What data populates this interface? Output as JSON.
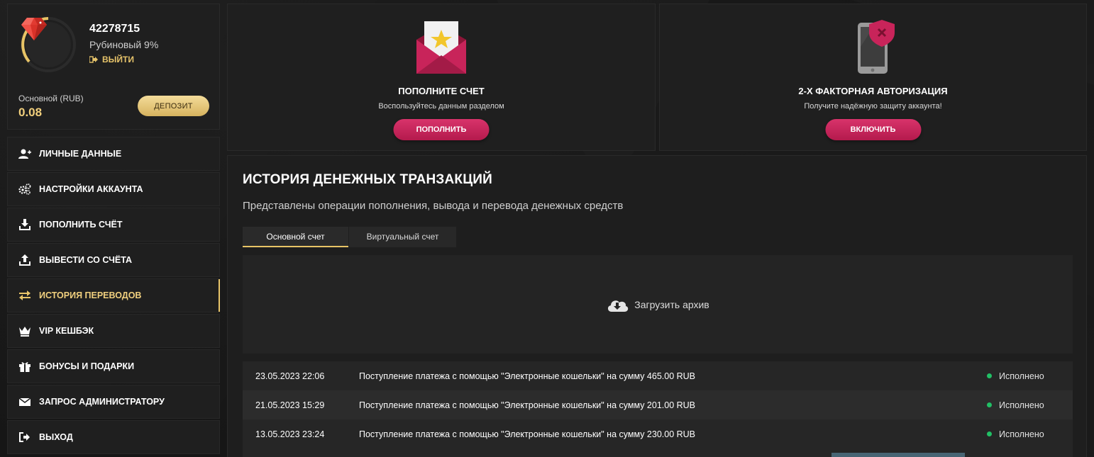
{
  "profile": {
    "user_id": "42278715",
    "level": "Рубиновый 9%",
    "logout_label": "ВЫЙТИ",
    "balance_label": "Основной (RUB)",
    "balance_value": "0.08",
    "deposit_label": "ДЕПОЗИТ",
    "level_progress_percent": 9
  },
  "menu": [
    {
      "label": "ЛИЧНЫЕ ДАННЫЕ",
      "icon": "user-plus-icon",
      "active": false
    },
    {
      "label": "НАСТРОЙКИ АККАУНТА",
      "icon": "gears-icon",
      "active": false
    },
    {
      "label": "ПОПОЛНИТЬ СЧЁТ",
      "icon": "download-tray-icon",
      "active": false
    },
    {
      "label": "ВЫВЕСТИ СО СЧЁТА",
      "icon": "upload-tray-icon",
      "active": false
    },
    {
      "label": "ИСТОРИЯ ПЕРЕВОДОВ",
      "icon": "exchange-arrows-icon",
      "active": true
    },
    {
      "label": "VIP КЕШБЭК",
      "icon": "crown-icon",
      "active": false
    },
    {
      "label": "БОНУСЫ И ПОДАРКИ",
      "icon": "gift-icon",
      "active": false
    },
    {
      "label": "ЗАПРОС АДМИНИСТРАТОРУ",
      "icon": "envelope-icon",
      "active": false
    },
    {
      "label": "ВЫХОД",
      "icon": "sign-out-icon",
      "active": false
    }
  ],
  "cards": {
    "deposit": {
      "title": "ПОПОЛНИТЕ СЧЕТ",
      "subtitle": "Воспользуйтесь данным разделом",
      "button": "ПОПОЛНИТЬ",
      "icon": "envelope-star-icon"
    },
    "twofa": {
      "title": "2-Х ФАКТОРНАЯ АВТОРИЗАЦИЯ",
      "subtitle": "Получите надёжную защиту аккаунта!",
      "button": "ВКЛЮЧИТЬ",
      "icon": "phone-shield-icon"
    }
  },
  "history": {
    "title": "ИСТОРИЯ ДЕНЕЖНЫХ ТРАНЗАКЦИЙ",
    "description": "Представлены операции пополнения, вывода и перевода денежных средств",
    "tabs": [
      "Основной счет",
      "Виртуальный счет"
    ],
    "archive_label": "Загрузить архив",
    "rows": [
      {
        "date": "23.05.2023 22:06",
        "text": "Поступление платежа с помощью \"Электронные кошельки\" на сумму 465.00 RUB",
        "status": "Исполнено"
      },
      {
        "date": "21.05.2023 15:29",
        "text": "Поступление платежа с помощью \"Электронные кошельки\" на сумму 201.00 RUB",
        "status": "Исполнено"
      },
      {
        "date": "13.05.2023 23:24",
        "text": "Поступление платежа с помощью \"Электронные кошельки\" на сумму 230.00 RUB",
        "status": "Исполнено"
      }
    ]
  },
  "colors": {
    "accent_gold": "#e9c56a",
    "accent_pink": "#c8245a",
    "status_green": "#21c065"
  }
}
